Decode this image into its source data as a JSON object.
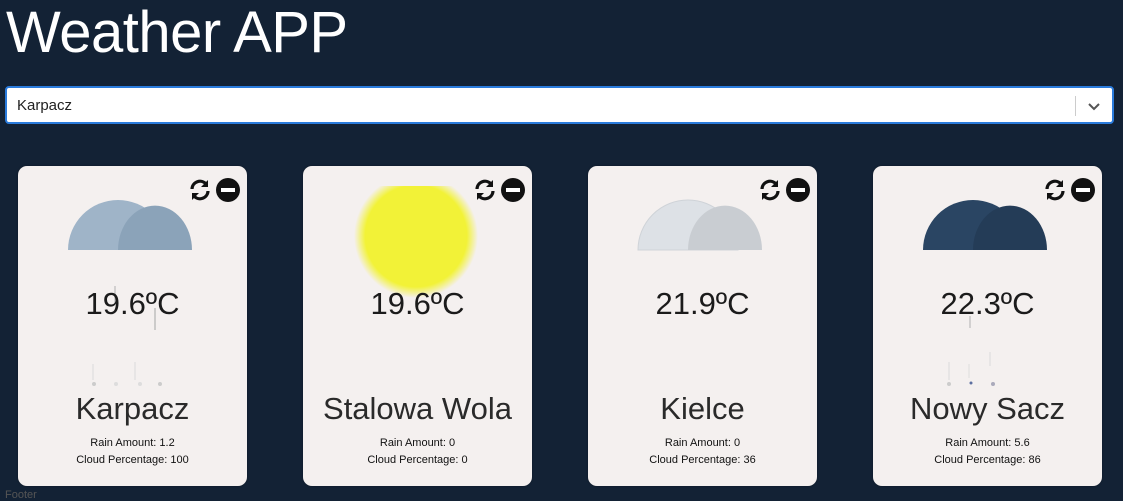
{
  "app": {
    "title": "Weather APP"
  },
  "select": {
    "value": "Karpacz"
  },
  "labels": {
    "rain": "Rain Amount:",
    "cloud": "Cloud Percentage:"
  },
  "cards": [
    {
      "temp": "19.6ºC",
      "city": "Karpacz",
      "rain": "1.2",
      "cloud": "100",
      "icon": "cloud-rain-icon",
      "cloud_color": "#9fb4c8"
    },
    {
      "temp": "19.6ºC",
      "city": "Stalowa Wola",
      "rain": "0",
      "cloud": "0",
      "icon": "sun-icon",
      "sun_color": "#f2f237"
    },
    {
      "temp": "21.9ºC",
      "city": "Kielce",
      "rain": "0",
      "cloud": "36",
      "icon": "cloud-icon",
      "cloud_color": "#dde1e6"
    },
    {
      "temp": "22.3ºC",
      "city": "Nowy Sacz",
      "rain": "5.6",
      "cloud": "86",
      "icon": "cloud-rain-icon",
      "cloud_color": "#2a4563"
    }
  ],
  "footer": {
    "text": "Footer"
  }
}
